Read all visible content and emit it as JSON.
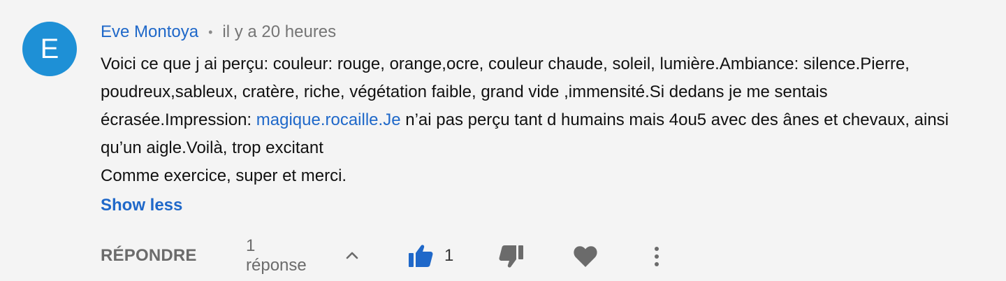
{
  "comment": {
    "avatar_letter": "E",
    "author": "Eve Montoya",
    "separator": "•",
    "time": "il y a 20 heures",
    "text_before_link": "Voici ce que j ai perçu: couleur: rouge, orange,ocre, couleur chaude, soleil, lumière.Ambiance: silence.Pierre, poudreux,sableux, cratère, riche, végétation faible, grand vide ,immensité.Si dedans je me sentais écrasée.Impression: ",
    "link_text": "magique.rocaille.Je",
    "text_after_link": " n’ai pas perçu tant d humains mais 4ou5 avec des ânes et chevaux, ainsi qu’un aigle.Voilà, trop excitant",
    "second_paragraph": "Comme exercice, super et merci.",
    "show_less": "Show less"
  },
  "actions": {
    "reply_label": "RÉPONDRE",
    "replies_label": "1 réponse",
    "like_count": "1"
  },
  "colors": {
    "accent": "#1f68c9",
    "avatar_bg": "#1e90d6",
    "muted": "#6b6b6b",
    "background": "#f4f4f4"
  },
  "icons": [
    "chevron-up-icon",
    "thumbs-up-icon",
    "thumbs-down-icon",
    "heart-icon",
    "more-vert-icon"
  ]
}
